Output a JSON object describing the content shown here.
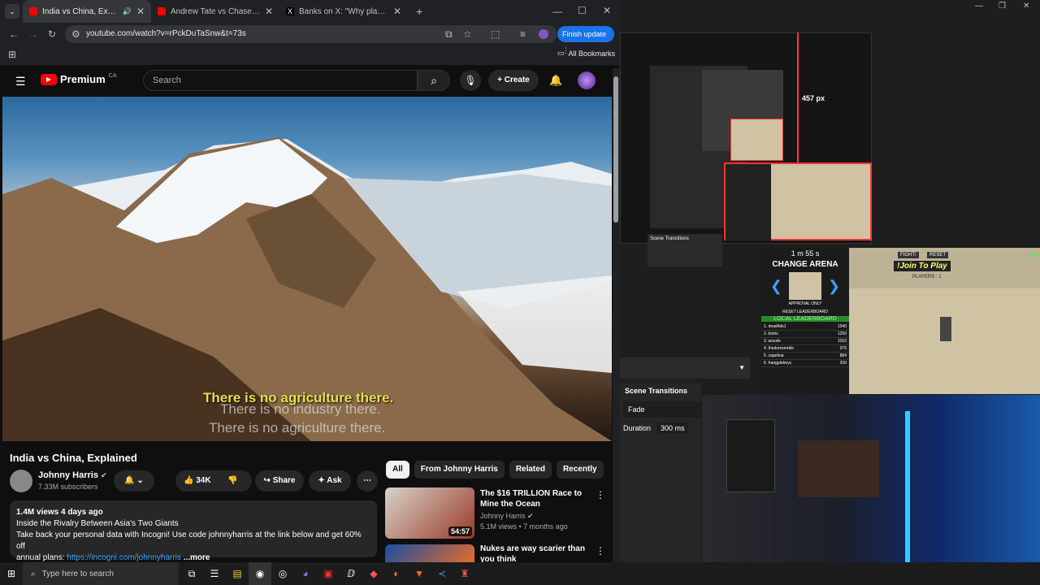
{
  "browser": {
    "tabs": [
      {
        "title": "India vs China, Explained - YouTube",
        "active": true
      },
      {
        "title": "Andrew Tate vs Chase DeMoor",
        "active": false
      },
      {
        "title": "Banks on X: \"Why plaqueboymax",
        "active": false
      }
    ],
    "url": "youtube.com/watch?v=rPckDuTaSnw&t=73s",
    "finish_update": "Finish update",
    "all_bookmarks": "All Bookmarks"
  },
  "youtube": {
    "logo": "Premium",
    "region": "CA",
    "search_placeholder": "Search",
    "create": "Create",
    "subtitles": [
      "There is no agriculture there.",
      "There is no industry there.",
      "There is no agriculture there."
    ],
    "video_title": "India vs China, Explained",
    "channel": "Johnny Harris",
    "subscribers": "7.33M subscribers",
    "likes": "34K",
    "share": "Share",
    "ask": "Ask",
    "views_date": "1.4M views  4 days ago",
    "desc_line1": "Inside the Rivalry Between Asia's Two Giants",
    "desc_line2": "Take back your personal data with Incogni! Use code johnnyharris at the link below and get 60% off",
    "desc_line3_prefix": "annual plans: ",
    "desc_link": "https://incogni.com/johnnyharris",
    "more": "...more",
    "chips": [
      "All",
      "From Johnny Harris",
      "Related",
      "Recently"
    ],
    "recommendations": [
      {
        "title": "The $16 TRILLION Race to Mine the Ocean",
        "channel": "Johnny Harris",
        "meta": "5.1M views • 7 months ago",
        "duration": "54:57"
      },
      {
        "title": "Nukes are way scarier than you think",
        "channel": "",
        "meta": "",
        "duration": ""
      }
    ]
  },
  "obs": {
    "measure": "457 px",
    "timer": "1 m 55 s",
    "change_arena": "CHANGE ARENA",
    "approval_only": "APPROVAL ONLY",
    "reset_leaderboard": "RESET LEADERBOARD",
    "local_leaderboard": "LOCAL LEADERBOARD",
    "fight": "FIGHT!",
    "reset": "RESET",
    "join": "!Join To Play",
    "players": "PLAYERS : 1",
    "leaderboard": [
      {
        "name": "1. dead4ds1",
        "score": "1540"
      },
      {
        "name": "2. botris",
        "score": "1250"
      },
      {
        "name": "3. wozzle",
        "score": "1010"
      },
      {
        "name": "4. thedomsmrkle",
        "score": "975"
      },
      {
        "name": "5. capefear",
        "score": "884"
      },
      {
        "name": "6. frangpleboyc",
        "score": "200"
      }
    ],
    "scene_transitions": "Scene Transitions",
    "fade": "Fade",
    "duration_label": "Duration",
    "duration_value": "300 ms"
  },
  "taskbar": {
    "search_placeholder": "Type here to search"
  }
}
